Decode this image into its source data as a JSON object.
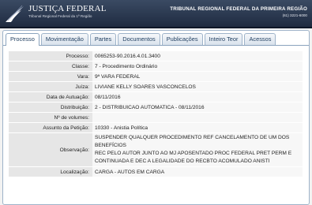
{
  "header": {
    "logo_title": "Justiça Federal",
    "logo_subtitle": "Tribunal Regional Federal da 1ª Região",
    "court_name": "TRIBUNAL REGIONAL FEDERAL DA PRIMEIRA REGIÃO",
    "court_phone": "(61) 3221-6000"
  },
  "tabs": [
    {
      "label": "Processo",
      "active": true
    },
    {
      "label": "Movimentação"
    },
    {
      "label": "Partes"
    },
    {
      "label": "Documentos"
    },
    {
      "label": "Publicações"
    },
    {
      "label": "Inteiro Teor"
    },
    {
      "label": "Acessos"
    }
  ],
  "details": {
    "processo": {
      "label": "Processo:",
      "value": "0065253-90.2016.4.01.3400"
    },
    "classe": {
      "label": "Classe:",
      "value": "7 - Procedimento Ordinário"
    },
    "vara": {
      "label": "Vara:",
      "value": "9ª VARA FEDERAL"
    },
    "juiza": {
      "label": "Juíza:",
      "value": "LIVIANE KELLY SOARES VASCONCELOS"
    },
    "data_autuacao": {
      "label": "Data de Autuação:",
      "value": "08/11/2016"
    },
    "distribuicao": {
      "label": "Distribuição:",
      "value": "2 - DISTRIBUICAO AUTOMATICA - 08/11/2016"
    },
    "volumes": {
      "label": "Nº de volumes:",
      "value": ""
    },
    "assunto": {
      "label": "Assunto da Petição:",
      "value": "10330 - Anistia Política"
    },
    "observacao": {
      "label": "Observação:",
      "line1": "SUSPENDER QUALQUER PROCEDIMENTO REF CANCELAMENTO DE UM DOS BENEFÍCIOS",
      "line2": "REC PELO AUTOR JUNTO AO MJ APOSENTADO PROC FEDERAL PRET PERM E",
      "line3": "CONTINUADA E DEC A LEGALIDADE DO RECBTO ACOMULADO ANISTI"
    },
    "localizacao": {
      "label": "Localização:",
      "value": "CARGA - AUTOS EM CARGA"
    }
  }
}
